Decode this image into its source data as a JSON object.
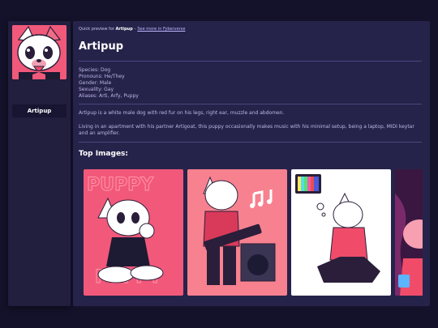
{
  "sidebar": {
    "name": "Artipup",
    "avatar_icon": "dog-avatar-icon"
  },
  "header": {
    "preview_prefix": "Quick preview for ",
    "preview_name": "Artipup",
    "preview_sep": " – ",
    "preview_link": "See more in Fyberverse"
  },
  "profile": {
    "title": "Artipup",
    "facts": [
      "Species: Dog",
      "Pronouns: He/They",
      "Gender: Male",
      "Sexuality: Gay",
      "Aliases: Arti, Arfy, Puppy"
    ],
    "bio_1": "Artipup is a white male dog with red fur on his legs, right ear, muzzle and abdomen.",
    "bio_2": "Living in an apartment with his partner Artigoat, this puppy occasionally makes music with his minimal setup, being a laptop, MIDI keytar and an amplifier."
  },
  "top_images": {
    "heading": "Top Images:",
    "images": [
      {
        "name": "puppy-poster-image",
        "bg": "#f2587a",
        "watermark": "PUPPY"
      },
      {
        "name": "keytar-image",
        "bg": "#f7818f"
      },
      {
        "name": "tv-image",
        "bg": "#ffffff"
      },
      {
        "name": "partial-image",
        "bg": "#3a1740"
      }
    ]
  },
  "colors": {
    "accent": "#f2587a",
    "panel": "#26234a",
    "sidebar": "#211e3e",
    "background": "#14122a"
  }
}
